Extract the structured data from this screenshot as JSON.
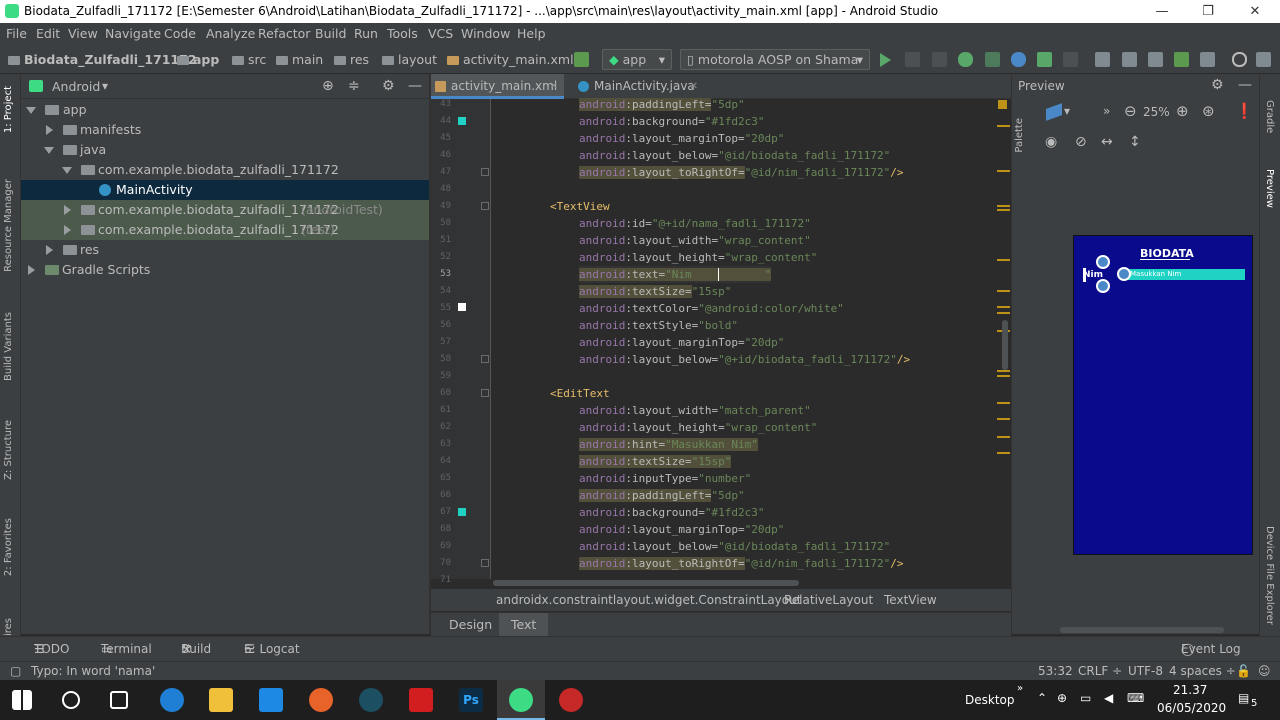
{
  "window": {
    "title": "Biodata_Zulfadli_171172 [E:\\Semester 6\\Android\\Latihan\\Biodata_Zulfadli_171172] - ...\\app\\src\\main\\res\\layout\\activity_main.xml [app] - Android Studio",
    "minimize": "—",
    "maximize": "❐",
    "close": "✕"
  },
  "menu": [
    "File",
    "Edit",
    "View",
    "Navigate",
    "Code",
    "Analyze",
    "Refactor",
    "Build",
    "Run",
    "Tools",
    "VCS",
    "Window",
    "Help"
  ],
  "nav": {
    "crumbs": [
      "Biodata_Zulfadli_171172",
      "app",
      "src",
      "main",
      "res",
      "layout",
      "activity_main.xml"
    ],
    "config": "app",
    "device": "motorola AOSP on Shama"
  },
  "left_strip": {
    "project": "1: Project",
    "resource_manager": "Resource Manager",
    "build_variants": "Build Variants",
    "structure": "Z: Structure",
    "favorites": "2: Favorites",
    "captures": "ires"
  },
  "right_strip": {
    "gradle": "Gradle",
    "preview": "Preview",
    "device_file": "Device File Explorer",
    "palette": "Palette"
  },
  "project": {
    "view_mode": "Android",
    "tree": [
      {
        "label": "app",
        "suffix": ""
      },
      {
        "label": "manifests",
        "suffix": ""
      },
      {
        "label": "java",
        "suffix": ""
      },
      {
        "label": "com.example.biodata_zulfadli_171172",
        "suffix": ""
      },
      {
        "label": "MainActivity",
        "suffix": ""
      },
      {
        "label": "com.example.biodata_zulfadli_171172",
        "suffix": "(androidTest)"
      },
      {
        "label": "com.example.biodata_zulfadli_171172",
        "suffix": "(test)"
      },
      {
        "label": "res",
        "suffix": ""
      },
      {
        "label": "Gradle Scripts",
        "suffix": ""
      }
    ]
  },
  "editor": {
    "tabs": [
      "activity_main.xml",
      "MainActivity.java"
    ],
    "line_numbers": [
      "43",
      "44",
      "45",
      "46",
      "47",
      "48",
      "49",
      "50",
      "51",
      "52",
      "53",
      "54",
      "55",
      "56",
      "57",
      "58",
      "59",
      "60",
      "61",
      "62",
      "63",
      "64",
      "65",
      "66",
      "67",
      "68",
      "69",
      "70",
      "71"
    ],
    "current_line": "53",
    "lines": {
      "l1_ns": "android",
      "l1_attr": ":paddingLeft=",
      "l1_val": "\"5dp\"",
      "l2_ns": "android",
      "l2_attr": ":background=",
      "l2_val": "\"#1fd2c3\"",
      "l3_ns": "android",
      "l3_attr": ":layout_marginTop=",
      "l3_val": "\"20dp\"",
      "l4_ns": "android",
      "l4_attr": ":layout_below=",
      "l4_val": "\"@id/biodata_fadli_171172\"",
      "l5_ns": "android",
      "l5_attr": ":layout_toRightOf=",
      "l5_val": "\"@id/nim_fadli_171172\"",
      "l5_end": "/>",
      "l7_tag": "<TextView",
      "l8_ns": "android",
      "l8_attr": ":id=",
      "l8_val": "\"@+id/nama_fadli_171172\"",
      "l9_ns": "android",
      "l9_attr": ":layout_width=",
      "l9_val": "\"wrap_content\"",
      "l10_ns": "android",
      "l10_attr": ":layout_height=",
      "l10_val": "\"wrap_content\"",
      "l11_ns": "android",
      "l11_attr": ":text=",
      "l11_val": "\"Nim           \"",
      "l12_ns": "android",
      "l12_attr": ":textSize=",
      "l12_val": "\"15sp\"",
      "l13_ns": "android",
      "l13_attr": ":textColor=",
      "l13_val": "\"@android:color/white\"",
      "l14_ns": "android",
      "l14_attr": ":textStyle=",
      "l14_val": "\"bold\"",
      "l15_ns": "android",
      "l15_attr": ":layout_marginTop=",
      "l15_val": "\"20dp\"",
      "l16_ns": "android",
      "l16_attr": ":layout_below=",
      "l16_val": "\"@+id/biodata_fadli_171172\"",
      "l16_end": "/>",
      "l18_tag": "<EditText",
      "l19_ns": "android",
      "l19_attr": ":layout_width=",
      "l19_val": "\"match_parent\"",
      "l20_ns": "android",
      "l20_attr": ":layout_height=",
      "l20_val": "\"wrap_content\"",
      "l21_ns": "android",
      "l21_attr": ":hint=",
      "l21_val": "\"Masukkan Nim\"",
      "l22_ns": "android",
      "l22_attr": ":textSize=",
      "l22_val": "\"15sp\"",
      "l23_ns": "android",
      "l23_attr": ":inputType=",
      "l23_val": "\"number\"",
      "l24_ns": "android",
      "l24_attr": ":paddingLeft=",
      "l24_val": "\"5dp\"",
      "l25_ns": "android",
      "l25_attr": ":background=",
      "l25_val": "\"#1fd2c3\"",
      "l26_ns": "android",
      "l26_attr": ":layout_marginTop=",
      "l26_val": "\"20dp\"",
      "l27_ns": "android",
      "l27_attr": ":layout_below=",
      "l27_val": "\"@id/biodata_fadli_171172\"",
      "l28_ns": "android",
      "l28_attr": ":layout_toRightOf=",
      "l28_val": "\"@id/nim_fadli_171172\"",
      "l28_end": "/>"
    },
    "breadcrumb": [
      "androidx.constraintlayout.widget.ConstraintLayout",
      "RelativeLayout",
      "TextView"
    ],
    "design_tabs": [
      "Design",
      "Text"
    ]
  },
  "preview": {
    "title": "Preview",
    "zoom": "25%",
    "phone_title": "BIODATA",
    "phone_label": "Nim",
    "phone_hint": "Masukkan Nim"
  },
  "bottom_tools": [
    "TODO",
    "Terminal",
    "Build",
    "6: Logcat",
    "Event Log"
  ],
  "status": {
    "message": "Typo: In word 'nama'",
    "position": "53:32",
    "line_sep": "CRLF ÷",
    "encoding": "UTF-8",
    "indent": "4 spaces ÷"
  },
  "taskbar": {
    "desktop": "Desktop",
    "time": "21.37",
    "date": "06/05/2020",
    "notif_count": "5"
  },
  "colors": {
    "accent": "#4a88c7",
    "phone_bg": "#0a0a8c",
    "edit_bg": "#1fd2c3",
    "android_green": "#3ddc84"
  }
}
